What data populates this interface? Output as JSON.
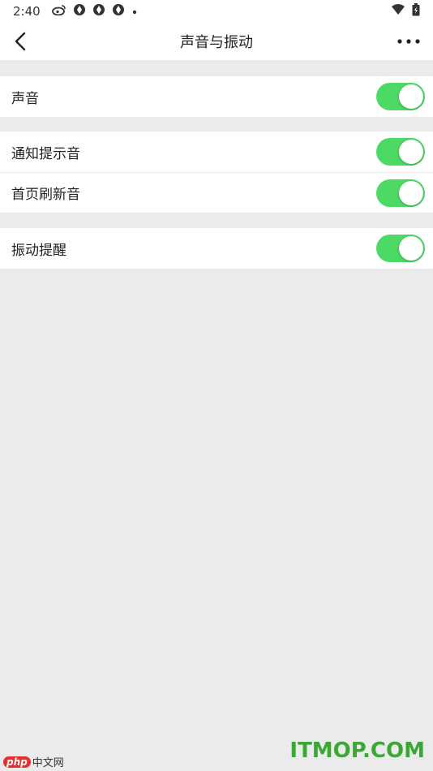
{
  "status_bar": {
    "time": "2:40",
    "icons": [
      "weibo-icon",
      "app-icon",
      "app-icon",
      "app-icon",
      "dot-icon"
    ],
    "right_icons": [
      "wifi-icon",
      "battery-icon"
    ]
  },
  "header": {
    "title": "声音与振动",
    "back_icon": "chevron-left-icon",
    "more_icon": "more-horizontal-icon"
  },
  "settings": {
    "sound": {
      "label": "声音",
      "enabled": true
    },
    "notification_sound": {
      "label": "通知提示音",
      "enabled": true
    },
    "refresh_sound": {
      "label": "首页刷新音",
      "enabled": true
    },
    "vibration": {
      "label": "振动提醒",
      "enabled": true
    }
  },
  "watermarks": {
    "left_badge": "php",
    "left_text": "中文网",
    "right_text": "ITMOP.COM"
  },
  "colors": {
    "toggle_on": "#4cd964",
    "background": "#ebebeb",
    "watermark_green": "#3aa835"
  }
}
